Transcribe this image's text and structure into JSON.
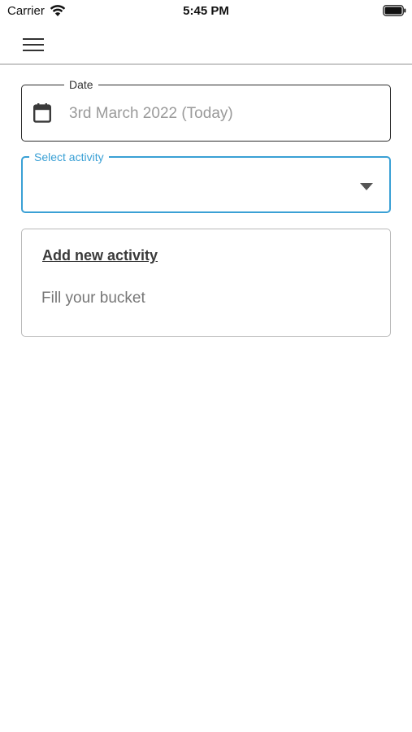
{
  "status_bar": {
    "carrier": "Carrier",
    "time": "5:45 PM",
    "icons": [
      "wifi-icon",
      "battery-icon"
    ]
  },
  "app_bar": {
    "menu_icon": "hamburger-menu-icon"
  },
  "date_field": {
    "label": "Date",
    "value": "3rd March 2022 (Today)",
    "icon": "calendar-icon"
  },
  "activity_field": {
    "label": "Select activity",
    "value": "",
    "icon": "dropdown-arrow-icon"
  },
  "activity_card": {
    "link_label": "Add new activity",
    "text": "Fill your bucket"
  },
  "colors": {
    "accent": "#3aa0d5",
    "border_dark": "#2b2b2b",
    "placeholder": "#9a9a9a",
    "divider": "#c9c9c9"
  }
}
